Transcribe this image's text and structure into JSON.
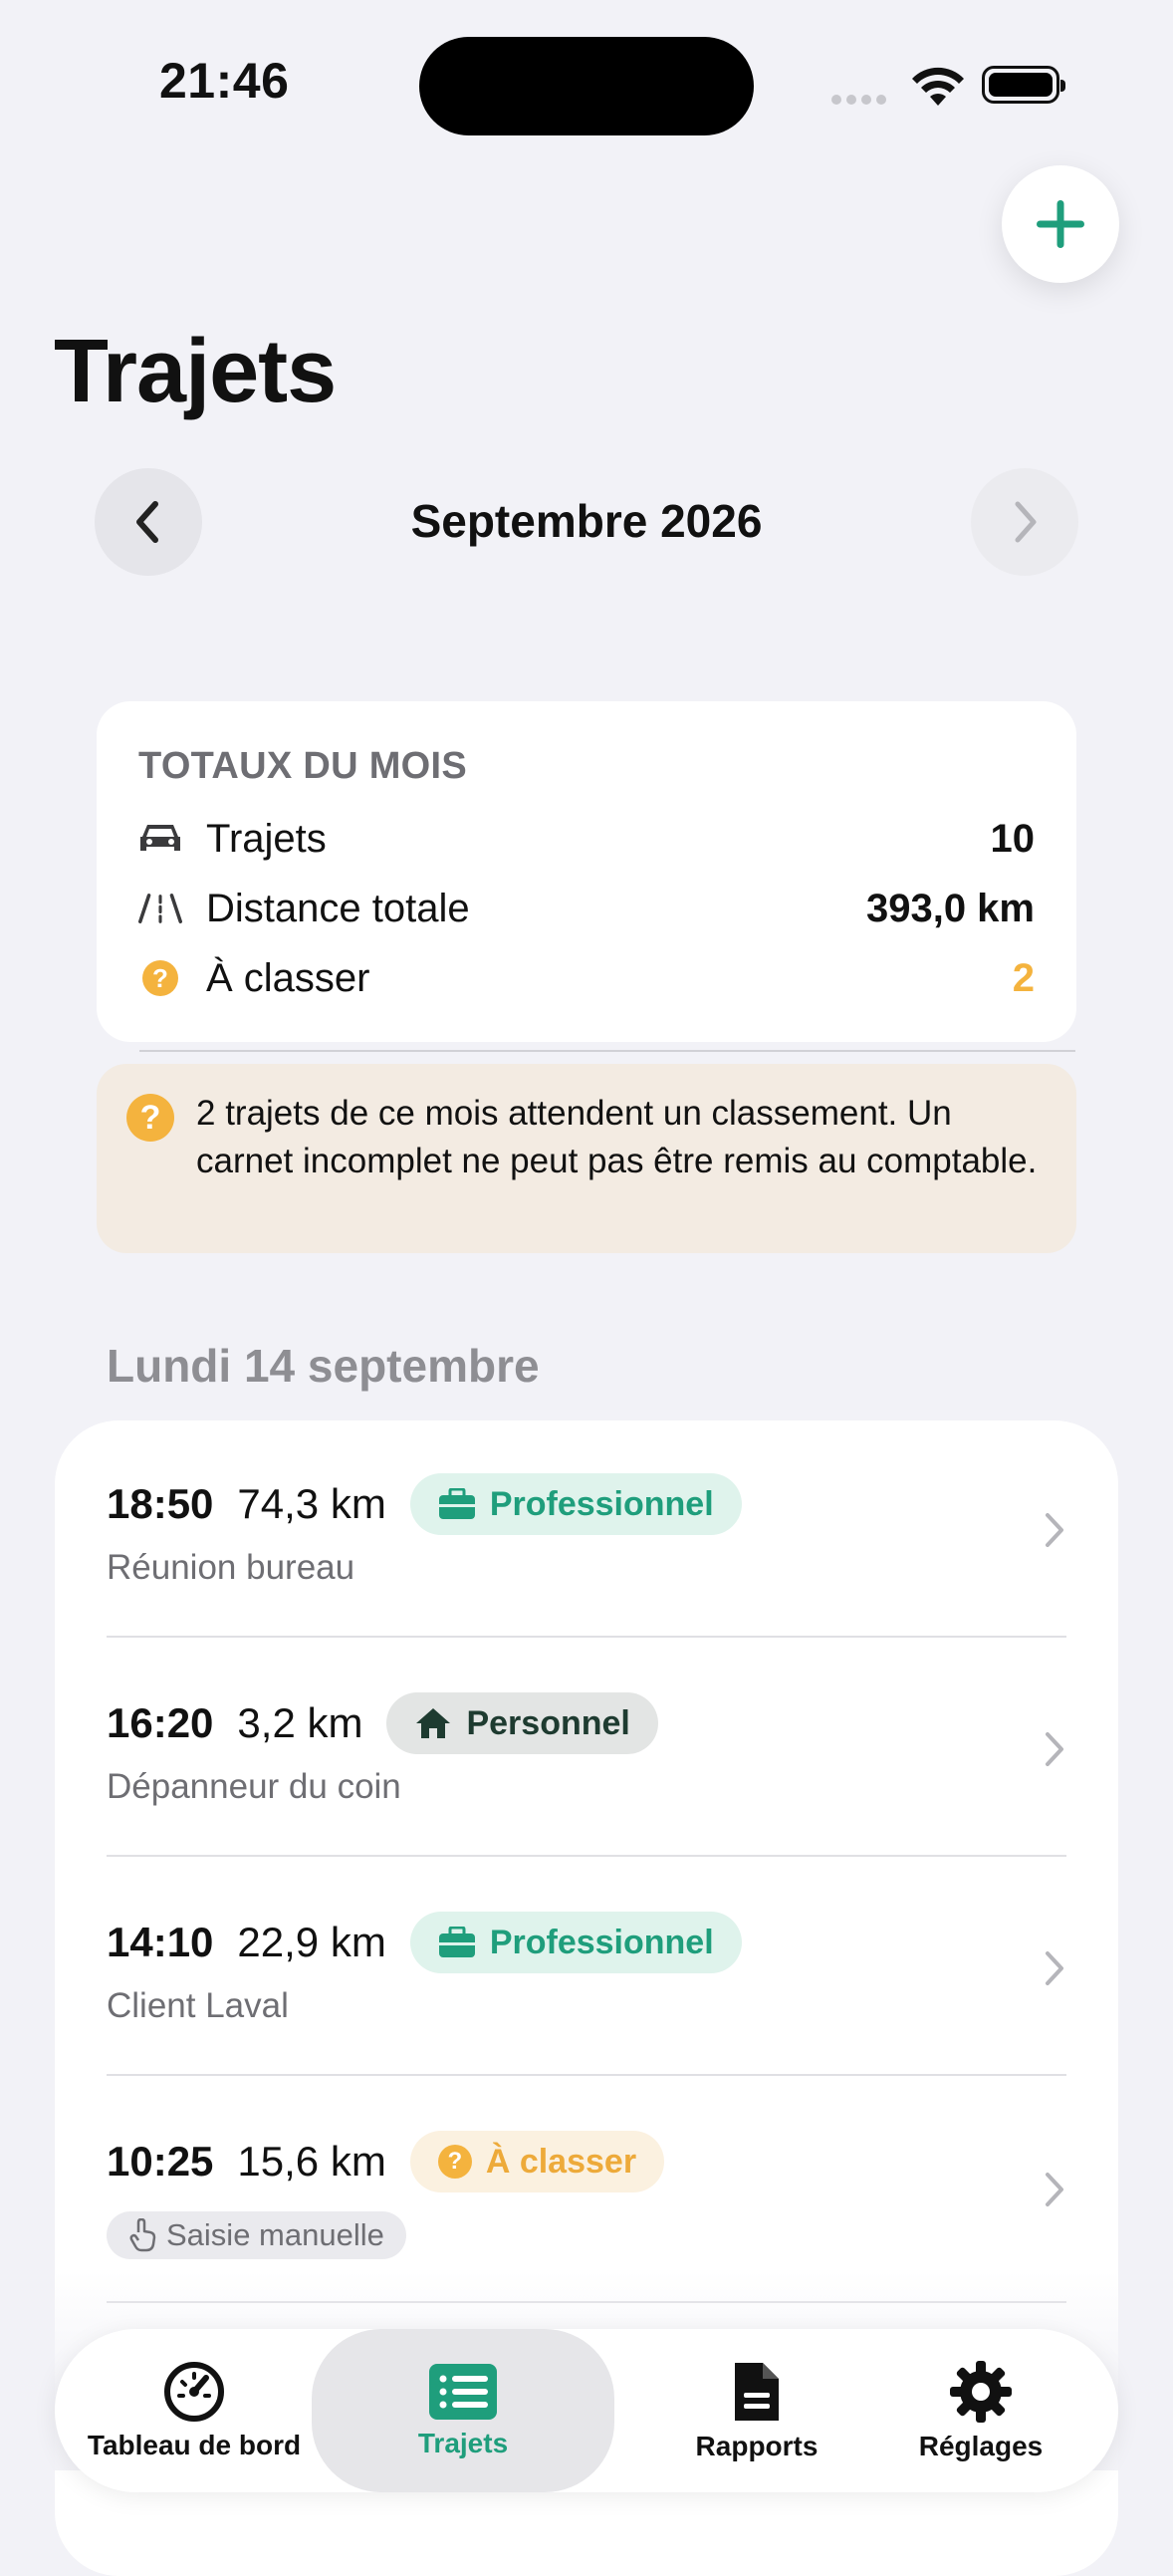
{
  "status_bar": {
    "time": "21:46"
  },
  "header": {
    "title": "Trajets",
    "month": "Septembre 2026"
  },
  "totals": {
    "heading": "TOTAUX DU MOIS",
    "rows": [
      {
        "icon": "car-icon",
        "label": "Trajets",
        "value": "10"
      },
      {
        "icon": "road-icon",
        "label": "Distance totale",
        "value": "393,0 km"
      },
      {
        "icon": "question-icon",
        "label": "À classer",
        "value": "2",
        "color": "#F4B33E"
      }
    ]
  },
  "warning": {
    "text": "2 trajets de ce mois attendent un classement. Un carnet incomplet ne peut pas être remis au comptable."
  },
  "day": {
    "heading": "Lundi 14 septembre"
  },
  "trips": [
    {
      "time": "18:50",
      "distance": "74,3 km",
      "category": "Professionnel",
      "category_type": "pro",
      "subtitle": "Réunion bureau"
    },
    {
      "time": "16:20",
      "distance": "3,2 km",
      "category": "Personnel",
      "category_type": "perso",
      "subtitle": "Dépanneur du coin"
    },
    {
      "time": "14:10",
      "distance": "22,9 km",
      "category": "Professionnel",
      "category_type": "pro",
      "subtitle": "Client Laval"
    },
    {
      "time": "10:25",
      "distance": "15,6 km",
      "category": "À classer",
      "category_type": "classer",
      "chip": "Saisie manuelle"
    }
  ],
  "tabs": [
    {
      "label": "Tableau de bord",
      "icon": "speedometer-icon"
    },
    {
      "label": "Trajets",
      "icon": "list-icon",
      "active": true
    },
    {
      "label": "Rapports",
      "icon": "document-icon"
    },
    {
      "label": "Réglages",
      "icon": "gear-icon"
    }
  ],
  "colors": {
    "accent": "#1F9E7C",
    "warning": "#F4B33E",
    "background": "#F2F2F7"
  }
}
